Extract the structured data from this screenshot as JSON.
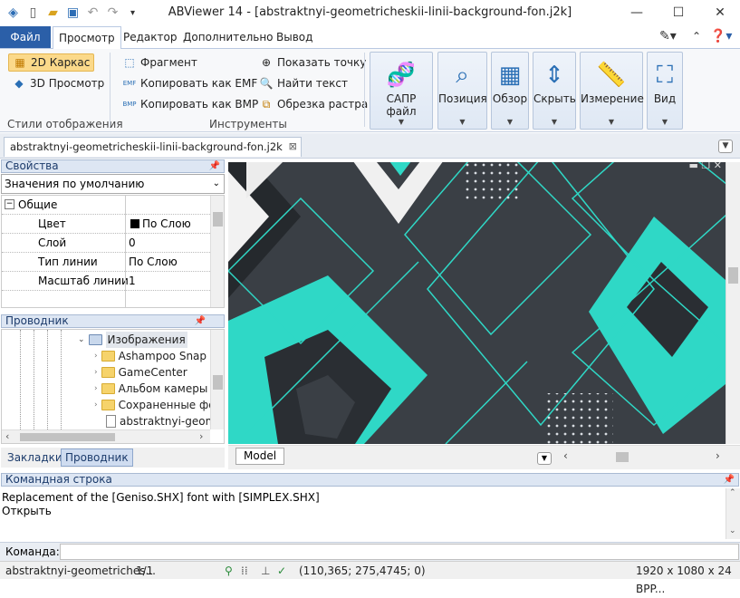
{
  "window": {
    "title": "ABViewer 14 - [abstraktnyi-geometricheskii-linii-background-fon.j2k]",
    "controls": {
      "minimize": "—",
      "maximize": "☐",
      "close": "✕"
    }
  },
  "quick_access": [
    "app-icon",
    "new-icon",
    "open-icon",
    "save-icon",
    "undo-icon",
    "redo-icon",
    "customize-icon"
  ],
  "ribbon_tabs": {
    "file": "Файл",
    "items": [
      "Просмотр",
      "Редактор",
      "Дополнительно",
      "Вывод"
    ],
    "active": "Просмотр"
  },
  "ribbon": {
    "display_styles": {
      "label": "Стили отображения",
      "wireframe_2d": "2D Каркас",
      "view_3d": "3D Просмотр"
    },
    "tools": {
      "label": "Инструменты",
      "fragment": "Фрагмент",
      "copy_emf": "Копировать как EMF",
      "copy_bmp": "Копировать как BMP",
      "show_point": "Показать точку",
      "find_text": "Найти текст",
      "crop_raster": "Обрезка растра"
    },
    "big_buttons": [
      "САПР файл",
      "Позиция",
      "Обзор",
      "Скрыть",
      "Измерение",
      "Вид"
    ]
  },
  "document_tab": "abstraktnyi-geometricheskii-linii-background-fon.j2k",
  "properties": {
    "header": "Свойства",
    "dropdown": "Значения по умолчанию",
    "category": "Общие",
    "rows": [
      {
        "name": "Цвет",
        "value": "По Слою",
        "swatch": "#000000"
      },
      {
        "name": "Слой",
        "value": "0"
      },
      {
        "name": "Тип линии",
        "value": "По Слою"
      },
      {
        "name": "Масштаб линии",
        "value": "1"
      }
    ]
  },
  "explorer": {
    "header": "Проводник",
    "root": "Изображения",
    "items": [
      "Ashampoo Snap",
      "GameCenter",
      "Альбом камеры",
      "Сохраненные фо",
      "abstraktnyi-geom"
    ]
  },
  "panel_tabs": {
    "bookmarks": "Закладки",
    "explorer": "Проводник"
  },
  "model_tab": "Model",
  "command_line": {
    "header": "Командная строка",
    "lines": [
      "Replacement of the [Geniso.SHX] font with [SIMPLEX.SHX]",
      "Открыть"
    ],
    "prompt": "Команда:"
  },
  "status_bar": {
    "file": "abstraktnyi-geometriches...",
    "page": "1/1",
    "coords": "(110,365; 275,4745; 0)",
    "image_info": "1920 x 1080 x 24 BPP..."
  },
  "colors": {
    "accent": "#2b5fa8",
    "teal": "#2fd8c6",
    "dark": "#2e3338"
  }
}
